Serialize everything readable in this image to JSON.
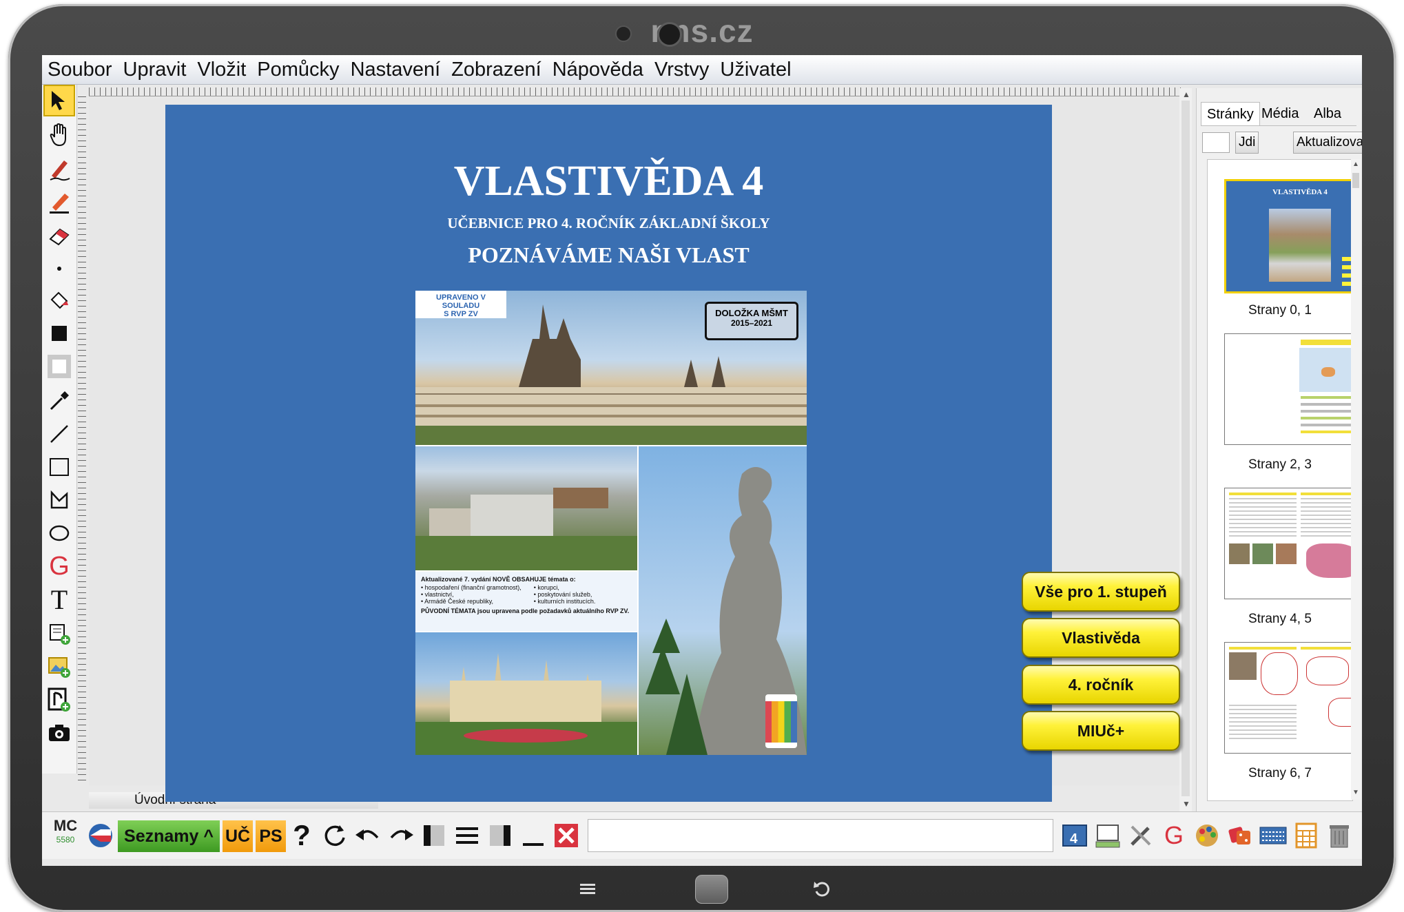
{
  "device": {
    "brand": "nns.cz"
  },
  "menu": [
    "Soubor",
    "Upravit",
    "Vložit",
    "Pomůcky",
    "Nastavení",
    "Zobrazení",
    "Nápověda",
    "Vrstvy",
    "Uživatel"
  ],
  "page": {
    "title": "VLASTIVĚDA 4",
    "subtitle": "UČEBNICE PRO 4. ROČNÍK ZÁKLADNÍ ŠKOLY",
    "subtitle2": "POZNÁVÁME NAŠI VLAST",
    "cover": {
      "badge": "UPRAVENO V SOULADU\nS RVP ZV",
      "stamp_title": "DOLOŽKA MŠMT",
      "stamp_years": "2015–2021",
      "info_heading": "Aktualizované 7. vydání NOVĚ OBSAHUJE témata o:",
      "info_col1": [
        "• hospodaření (finanční gramotnost),",
        "• vlastnictví,",
        "• Armádě České republiky,"
      ],
      "info_col2": [
        "• korupci,",
        "• poskytování služeb,",
        "• kulturních institucích."
      ],
      "info_footer": "PŮVODNÍ TÉMATA jsou upravena podle požadavků aktuálního RVP ZV.",
      "publisher": "nns.cz"
    },
    "buttons": [
      "Vše pro 1. stupeň",
      "Vlastivěda",
      "4. ročník",
      "MIUč+"
    ],
    "label": "Úvodní strana"
  },
  "side_panel": {
    "tabs": [
      "Stránky",
      "Média",
      "Alba"
    ],
    "active_tab": "Stránky",
    "goto_button": "Jdi",
    "refresh_button": "Aktualizovat",
    "goto_value": "",
    "thumbnails": [
      "Strany 0, 1",
      "Strany 2, 3",
      "Strany 4, 5",
      "Strany 6, 7"
    ]
  },
  "bottom_bar": {
    "mc_label": "MC",
    "mc_number": "5580",
    "lists_button": "Seznamy",
    "lists_caret": "^",
    "uc_button": "UČ",
    "ps_button": "PS",
    "help_glyph": "?"
  },
  "colors": {
    "page_bg": "#3a6fb2",
    "button_yellow": "#fff23a",
    "lists_green": "#5cb83a",
    "orange": "#f4a41c"
  }
}
